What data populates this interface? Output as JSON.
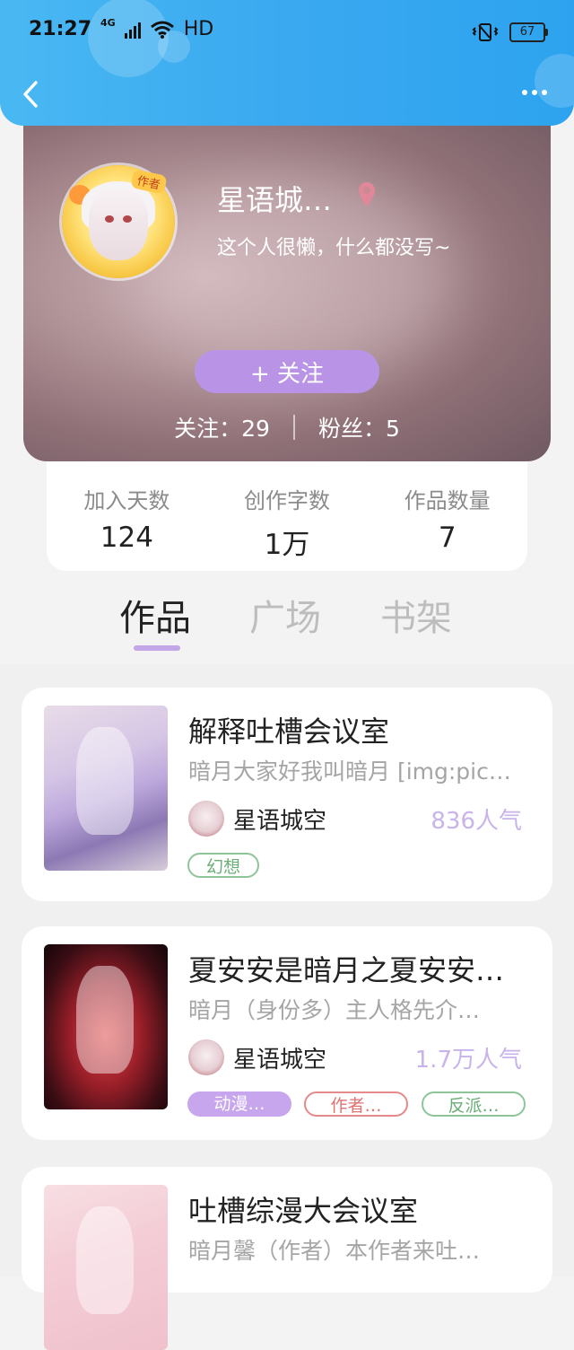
{
  "status_bar": {
    "time": "21:27",
    "network": "4G",
    "hd": "HD",
    "battery": "67"
  },
  "profile": {
    "name": "星语城…",
    "bio": "这个人很懒，什么都没写~",
    "avatar_badge": "作者",
    "follow_label": "+ 关注",
    "following_label": "关注：29",
    "followers_label": "粉丝：5"
  },
  "info": [
    {
      "label": "加入天数",
      "value": "124"
    },
    {
      "label": "创作字数",
      "value": "1万"
    },
    {
      "label": "作品数量",
      "value": "7"
    }
  ],
  "tabs": [
    "作品",
    "广场",
    "书架"
  ],
  "active_tab": "作品",
  "works": [
    {
      "title": "解释吐槽会议室",
      "desc": "暗月大家好我叫暗月 [img:pic…",
      "author": "星语城空",
      "popularity": "836人气",
      "tags": [
        "幻想"
      ]
    },
    {
      "title": "夏安安是暗月之夏安安…",
      "desc": "暗月（身份多）主人格先介…",
      "author": "星语城空",
      "popularity": "1.7万人气",
      "tags": [
        "动漫…",
        "作者…",
        "反派…"
      ]
    },
    {
      "title": "吐槽综漫大会议室",
      "desc": "暗月馨（作者）本作者来吐…"
    }
  ],
  "colors": {
    "header": "#3aa9f0",
    "accent_purple": "#b994e6",
    "popularity": "#c8b4ea"
  }
}
